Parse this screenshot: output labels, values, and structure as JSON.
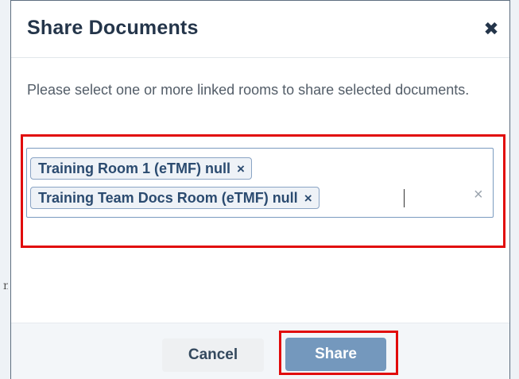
{
  "dialog": {
    "title": "Share Documents",
    "close_icon": "close-icon",
    "description": "Please select one or more linked rooms to share selected documents."
  },
  "room_select": {
    "selected": [
      {
        "label": "Training Room 1 (eTMF) null",
        "remove_glyph": "×"
      },
      {
        "label": "Training Team Docs Room (eTMF) null",
        "remove_glyph": "×"
      }
    ],
    "clear_glyph": "×"
  },
  "footer": {
    "cancel_label": "Cancel",
    "share_label": "Share"
  },
  "colors": {
    "title": "#24354a",
    "tag_border": "#8aa4c4",
    "share_button": "#7498bd",
    "highlight": "#e10b0b"
  },
  "background": {
    "left_glyph": "n"
  }
}
